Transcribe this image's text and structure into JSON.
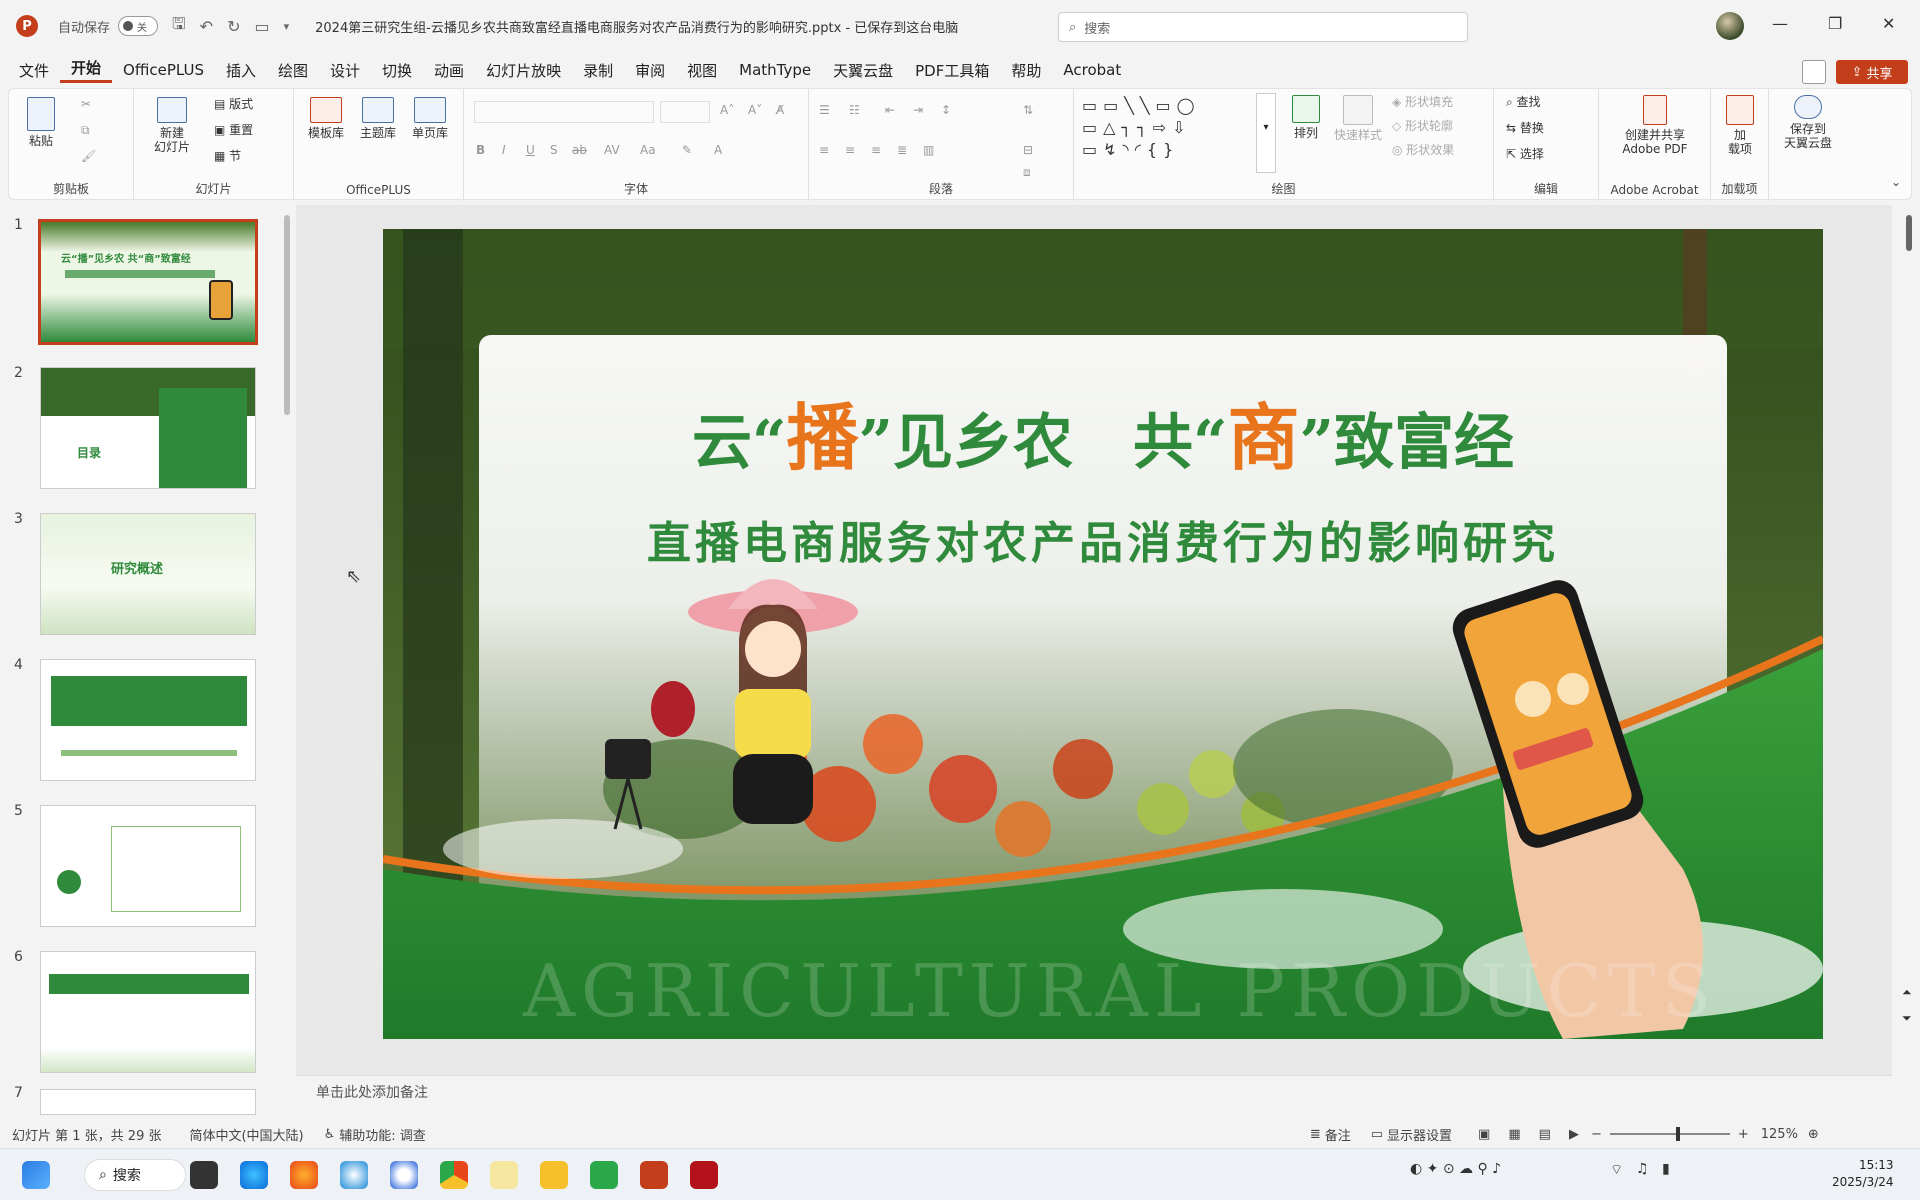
{
  "window": {
    "autosave_label": "自动保存",
    "autosave_state": "关",
    "doc_title": "2024第三研究生组-云播见乡农共商致富经直播电商服务对农产品消费行为的影响研究.pptx - 已保存到这台电脑",
    "search_placeholder": "搜索"
  },
  "menu": {
    "items": [
      "文件",
      "开始",
      "OfficePLUS",
      "插入",
      "绘图",
      "设计",
      "切换",
      "动画",
      "幻灯片放映",
      "录制",
      "审阅",
      "视图",
      "MathType",
      "天翼云盘",
      "PDF工具箱",
      "帮助",
      "Acrobat"
    ],
    "active": "开始",
    "share": "共享"
  },
  "ribbon": {
    "groups": {
      "clipboard": "剪贴板",
      "slides": "幻灯片",
      "officeplus": "OfficePLUS",
      "font": "字体",
      "paragraph": "段落",
      "drawing": "绘图",
      "editing": "编辑",
      "adobe": "Adobe Acrobat",
      "addins": "加载项"
    },
    "paste": "粘贴",
    "new_slide_1": "新建",
    "new_slide_2": "幻灯片",
    "layout": "版式",
    "reset": "重置",
    "section": "节",
    "template_lib": "模板库",
    "theme_lib": "主题库",
    "single_page_lib": "单页库",
    "arrange": "排列",
    "quick_styles": "快速样式",
    "shape_fill": "形状填充",
    "shape_outline": "形状轮廓",
    "shape_effects": "形状效果",
    "find": "查找",
    "replace": "替换",
    "select": "选择",
    "create_pdf_1": "创建并共享",
    "create_pdf_2": "Adobe PDF",
    "addin_1": "加",
    "addin_2": "载项",
    "save_cloud_1": "保存到",
    "save_cloud_2": "天翼云盘"
  },
  "thumbnails": [
    {
      "num": "1",
      "text": "云“播”见乡农 共“商”致富经"
    },
    {
      "num": "2",
      "text": "目录"
    },
    {
      "num": "3",
      "text": "研究概述"
    },
    {
      "num": "4",
      "text": ""
    },
    {
      "num": "5",
      "text": ""
    },
    {
      "num": "6",
      "text": ""
    },
    {
      "num": "7",
      "text": ""
    }
  ],
  "slide": {
    "title_a1": "云“",
    "title_a2": "播",
    "title_a3": "”见乡农",
    "title_b1": "共“",
    "title_b2": "商",
    "title_b3": "”致富经",
    "subtitle": "直播电商服务对农产品消费行为的影响研究",
    "watermark": "AGRICULTURAL PRODUCTS"
  },
  "notes_placeholder": "单击此处添加备注",
  "status": {
    "slide_info": "幻灯片 第 1 张，共 29 张",
    "language": "简体中文(中国大陆)",
    "accessibility": "辅助功能: 调查",
    "notes": "备注",
    "display_settings": "显示器设置",
    "zoom": "125%"
  },
  "taskbar": {
    "search": "搜索",
    "time": "15:13",
    "date": "2025/3/24"
  },
  "colors": {
    "accent": "#c43e1c",
    "slide_green": "#2f8a3b",
    "slide_orange": "#e8741c"
  }
}
